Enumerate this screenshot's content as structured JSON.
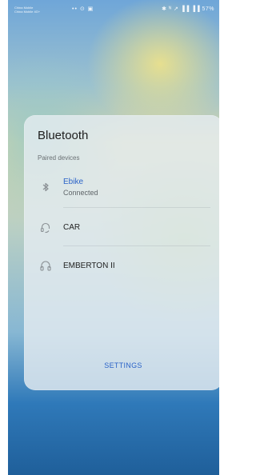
{
  "status_bar": {
    "carrier_line1": "China Mobile",
    "carrier_line2": "China Mobile 4G+",
    "left_icons": "•• ⊙ ▣",
    "right_icons": "✱ ᴺ ↗ ▐▐ ▐▐",
    "battery": "57%"
  },
  "bluetooth": {
    "title": "Bluetooth",
    "section_label": "Paired devices",
    "devices": [
      {
        "name": "Ebike",
        "status": "Connected",
        "icon": "bluetooth-icon"
      },
      {
        "name": "CAR",
        "status": "",
        "icon": "headset-icon"
      },
      {
        "name": "EMBERTON II",
        "status": "",
        "icon": "headphones-icon"
      }
    ],
    "settings_label": "SETTINGS"
  },
  "colors": {
    "accent": "#2b63c8"
  }
}
